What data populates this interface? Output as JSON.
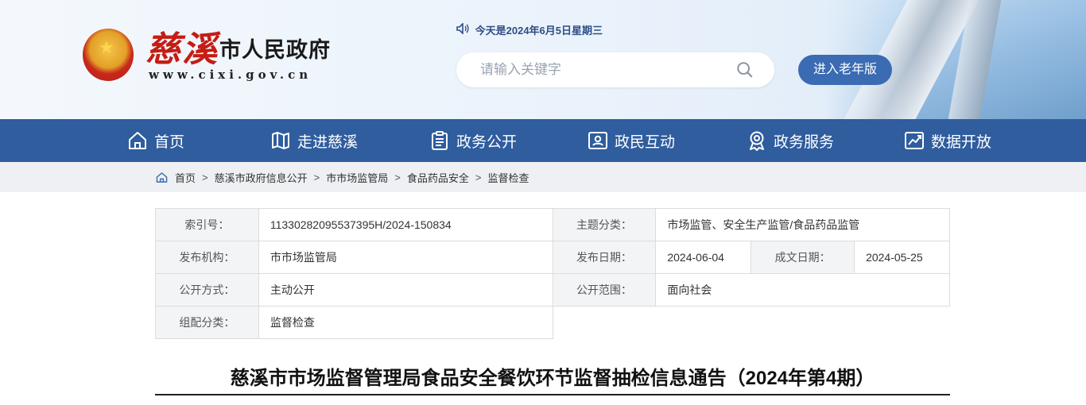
{
  "header": {
    "brand_cixi": "慈溪",
    "brand_gov": "市人民政府",
    "brand_url": "www.cixi.gov.cn",
    "date_text": "今天是2024年6月5日星期三",
    "search_placeholder": "请输入关键字",
    "elder_label": "进入老年版"
  },
  "nav": {
    "items": [
      {
        "label": "首页",
        "icon": "home-icon"
      },
      {
        "label": "走进慈溪",
        "icon": "map-icon"
      },
      {
        "label": "政务公开",
        "icon": "clipboard-icon"
      },
      {
        "label": "政民互动",
        "icon": "id-card-icon"
      },
      {
        "label": "政务服务",
        "icon": "medal-icon"
      },
      {
        "label": "数据开放",
        "icon": "chart-icon"
      }
    ]
  },
  "breadcrumb": [
    "首页",
    "慈溪市政府信息公开",
    "市市场监管局",
    "食品药品安全",
    "监督检查"
  ],
  "meta": {
    "index_label": "索引号：",
    "index_value": "11330282095537395H/2024-150834",
    "topic_label": "主题分类：",
    "topic_value": "市场监管、安全生产监管/食品药品监管",
    "org_label": "发布机构：",
    "org_value": "市市场监管局",
    "pub_date_label": "发布日期：",
    "pub_date_value": "2024-06-04",
    "doc_date_label": "成文日期：",
    "doc_date_value": "2024-05-25",
    "mode_label": "公开方式：",
    "mode_value": "主动公开",
    "scope_label": "公开范围：",
    "scope_value": "面向社会",
    "group_label": "组配分类：",
    "group_value": "监督检查"
  },
  "article": {
    "title": "慈溪市市场监督管理局食品安全餐饮环节监督抽检信息通告（2024年第4期）"
  },
  "colors": {
    "nav_bg": "#2f5d9e",
    "brand_red": "#c51c14",
    "elder_button": "#3a6bb3"
  }
}
